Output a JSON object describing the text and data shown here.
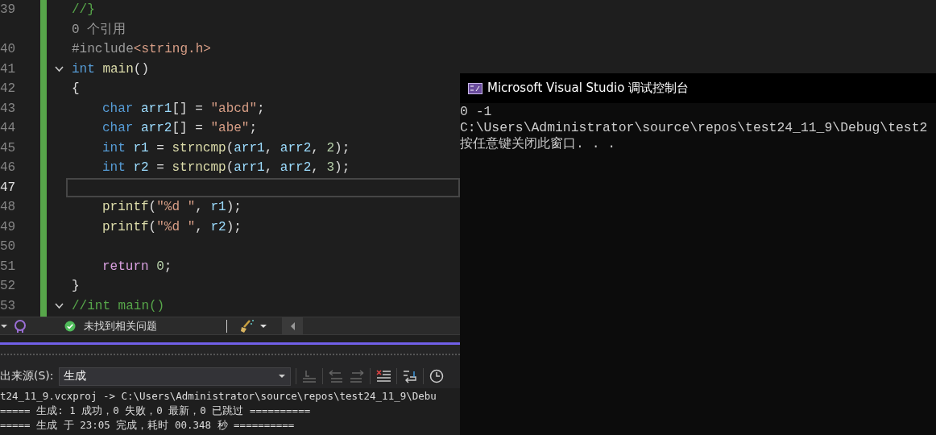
{
  "editor": {
    "lines": [
      {
        "kind": "code",
        "number": "39",
        "selected": false,
        "foldable": false,
        "tokens": [
          {
            "kind": "comment",
            "text": "//}"
          }
        ]
      },
      {
        "kind": "codelens",
        "text": "0 个引用"
      },
      {
        "kind": "code",
        "number": "40",
        "selected": false,
        "foldable": false,
        "tokens": [
          {
            "kind": "preproc",
            "text": "#include"
          },
          {
            "kind": "string",
            "text": "<string.h>"
          }
        ]
      },
      {
        "kind": "code",
        "number": "41",
        "selected": false,
        "foldable": true,
        "tokens": [
          {
            "kind": "keyword",
            "text": "int "
          },
          {
            "kind": "function",
            "text": "main"
          },
          {
            "kind": "plain",
            "text": "()"
          }
        ]
      },
      {
        "kind": "code",
        "number": "42",
        "selected": false,
        "foldable": false,
        "tokens": [
          {
            "kind": "plain",
            "text": "{"
          }
        ]
      },
      {
        "kind": "block_code",
        "number": "43",
        "selected": false,
        "foldable": false,
        "tokens": [
          {
            "kind": "keyword",
            "text": "char "
          },
          {
            "kind": "variable",
            "text": "arr1"
          },
          {
            "kind": "plain",
            "text": "[] = "
          },
          {
            "kind": "string",
            "text": "\"abcd\""
          },
          {
            "kind": "plain",
            "text": ";"
          }
        ]
      },
      {
        "kind": "block_code",
        "number": "44",
        "selected": false,
        "foldable": false,
        "tokens": [
          {
            "kind": "keyword",
            "text": "char "
          },
          {
            "kind": "variable",
            "text": "arr2"
          },
          {
            "kind": "plain",
            "text": "[] = "
          },
          {
            "kind": "string",
            "text": "\"abe\""
          },
          {
            "kind": "plain",
            "text": ";"
          }
        ]
      },
      {
        "kind": "block_code",
        "number": "45",
        "selected": false,
        "foldable": false,
        "tokens": [
          {
            "kind": "keyword",
            "text": "int "
          },
          {
            "kind": "variable",
            "text": "r1"
          },
          {
            "kind": "plain",
            "text": " = "
          },
          {
            "kind": "function",
            "text": "strncmp"
          },
          {
            "kind": "plain",
            "text": "("
          },
          {
            "kind": "variable",
            "text": "arr1"
          },
          {
            "kind": "plain",
            "text": ", "
          },
          {
            "kind": "variable",
            "text": "arr2"
          },
          {
            "kind": "plain",
            "text": ", "
          },
          {
            "kind": "number",
            "text": "2"
          },
          {
            "kind": "plain",
            "text": ");"
          }
        ]
      },
      {
        "kind": "block_code",
        "number": "46",
        "selected": false,
        "foldable": false,
        "tokens": [
          {
            "kind": "keyword",
            "text": "int "
          },
          {
            "kind": "variable",
            "text": "r2"
          },
          {
            "kind": "plain",
            "text": " = "
          },
          {
            "kind": "function",
            "text": "strncmp"
          },
          {
            "kind": "plain",
            "text": "("
          },
          {
            "kind": "variable",
            "text": "arr1"
          },
          {
            "kind": "plain",
            "text": ", "
          },
          {
            "kind": "variable",
            "text": "arr2"
          },
          {
            "kind": "plain",
            "text": ", "
          },
          {
            "kind": "number",
            "text": "3"
          },
          {
            "kind": "plain",
            "text": ");"
          }
        ]
      },
      {
        "kind": "block_code",
        "number": "47",
        "selected": true,
        "foldable": false
      },
      {
        "kind": "block_code",
        "number": "48",
        "selected": false,
        "foldable": false,
        "tokens": [
          {
            "kind": "function",
            "text": "printf"
          },
          {
            "kind": "plain",
            "text": "("
          },
          {
            "kind": "string",
            "text": "\"%d \""
          },
          {
            "kind": "plain",
            "text": ", "
          },
          {
            "kind": "variable",
            "text": "r1"
          },
          {
            "kind": "plain",
            "text": ");"
          }
        ]
      },
      {
        "kind": "block_code",
        "number": "49",
        "selected": false,
        "foldable": false,
        "tokens": [
          {
            "kind": "function",
            "text": "printf"
          },
          {
            "kind": "plain",
            "text": "("
          },
          {
            "kind": "string",
            "text": "\"%d \""
          },
          {
            "kind": "plain",
            "text": ", "
          },
          {
            "kind": "variable",
            "text": "r2"
          },
          {
            "kind": "plain",
            "text": ");"
          }
        ]
      },
      {
        "kind": "block_code",
        "number": "50",
        "selected": false,
        "foldable": false
      },
      {
        "kind": "block_code",
        "number": "51",
        "selected": false,
        "foldable": false,
        "tokens": [
          {
            "kind": "control",
            "text": "return "
          },
          {
            "kind": "number",
            "text": "0"
          },
          {
            "kind": "plain",
            "text": ";"
          }
        ]
      },
      {
        "kind": "code",
        "number": "52",
        "selected": false,
        "foldable": false,
        "tokens": [
          {
            "kind": "plain",
            "text": "}"
          }
        ]
      },
      {
        "kind": "code",
        "number": "53",
        "selected": false,
        "foldable": true,
        "tokens": [
          {
            "kind": "comment",
            "text": "//int main()"
          }
        ]
      }
    ]
  },
  "status_bar": {
    "issues": "未找到相关问题"
  },
  "output": {
    "source_label": "出来源(S):",
    "source_value": "生成",
    "lines": [
      "t24_11_9.vcxproj -> C:\\Users\\Administrator\\source\\repos\\test24_11_9\\Debu",
      "===== 生成: 1 成功，0 失败，0 最新，0 已跳过 ==========",
      "===== 生成 于 23:05 完成，耗时 00.348 秒 =========="
    ]
  },
  "console": {
    "title": "Microsoft Visual Studio 调试控制台",
    "lines": [
      "0 -1",
      "C:\\Users\\Administrator\\source\\repos\\test24_11_9\\Debug\\test2",
      "按任意键关闭此窗口. . ."
    ]
  }
}
